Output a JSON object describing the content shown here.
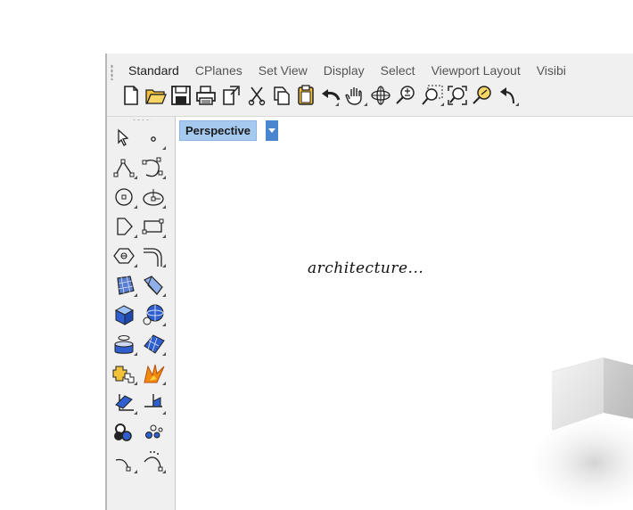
{
  "app": {
    "ribbon_tabs": [
      "Standard",
      "CPlanes",
      "Set View",
      "Display",
      "Select",
      "Viewport Layout",
      "Visibi"
    ],
    "active_tab": "Standard"
  },
  "toolbar": {
    "icons": [
      "new-file-icon",
      "open-folder-icon",
      "save-icon",
      "print-icon",
      "import-icon",
      "cut-icon",
      "copy-icon",
      "paste-icon",
      "undo-icon",
      "pan-hand-icon",
      "rotate-view-icon",
      "zoom-icon",
      "zoom-window-icon",
      "zoom-extents-icon",
      "zoom-selected-icon",
      "undo-view-icon"
    ]
  },
  "sidebar": {
    "icons": [
      "select-arrow-icon",
      "point-icon",
      "polyline-icon",
      "curve-icon",
      "circle-icon",
      "ellipse-icon",
      "polygon-icon",
      "rectangle-icon",
      "offset-curve-icon",
      "fillet-curve-icon",
      "surface-icon",
      "extrude-surface-icon",
      "box-solid-icon",
      "sphere-solid-icon",
      "cylinder-icon",
      "surface-mesh-icon",
      "boolean-icon",
      "explode-icon",
      "transform-icon",
      "cplane-icon",
      "group-icon",
      "point-cloud-icon",
      "dimension-icon",
      "curve-tools-icon"
    ]
  },
  "viewport": {
    "name": "Perspective",
    "annotation": "architecture..."
  },
  "colors": {
    "viewport_tab_bg": "#a6c9f0",
    "viewport_dropdown_bg": "#4a86d0",
    "chrome_bg": "#f0f0f0"
  }
}
